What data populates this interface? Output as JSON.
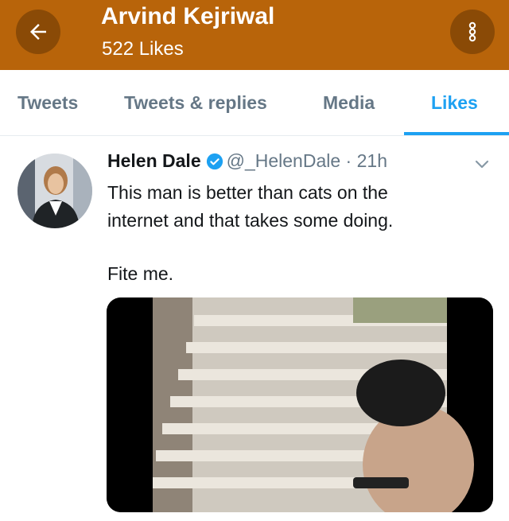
{
  "header": {
    "title": "Arvind Kejriwal",
    "subtitle": "522 Likes"
  },
  "tabs": [
    {
      "label": "Tweets"
    },
    {
      "label": "Tweets & replies"
    },
    {
      "label": "Media"
    },
    {
      "label": "Likes"
    }
  ],
  "tweet": {
    "name": "Helen Dale",
    "handle": "@_HelenDale",
    "time": "21h",
    "text_line1": "This man is better than cats on the",
    "text_line2": "internet and that takes some doing.",
    "text_line3": "Fite me."
  },
  "colors": {
    "header_bg": "#b8640a",
    "accent": "#1da1f2"
  }
}
